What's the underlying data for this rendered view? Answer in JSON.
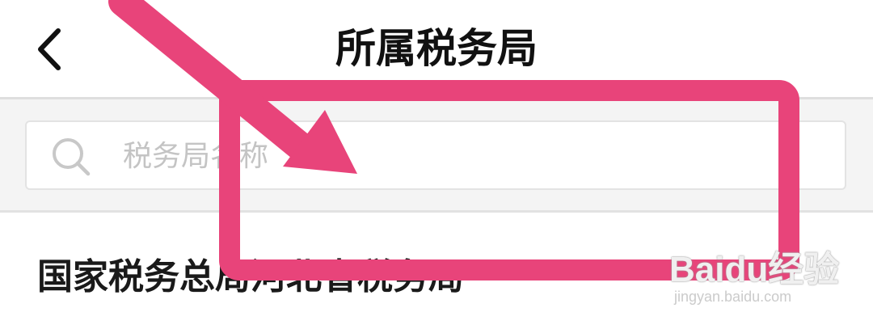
{
  "header": {
    "title": "所属税务局",
    "back_icon": "chevron-left-icon"
  },
  "search": {
    "placeholder": "税务局名称",
    "value": "",
    "icon": "search-icon"
  },
  "list": {
    "items": [
      {
        "label": "国家税务总局河北省税务局"
      }
    ]
  },
  "annotation": {
    "color": "#e8447a",
    "shapes": [
      "arrow",
      "rectangle"
    ]
  },
  "watermark": {
    "logo": "Baidu经验",
    "url": "jingyan.baidu.com"
  }
}
